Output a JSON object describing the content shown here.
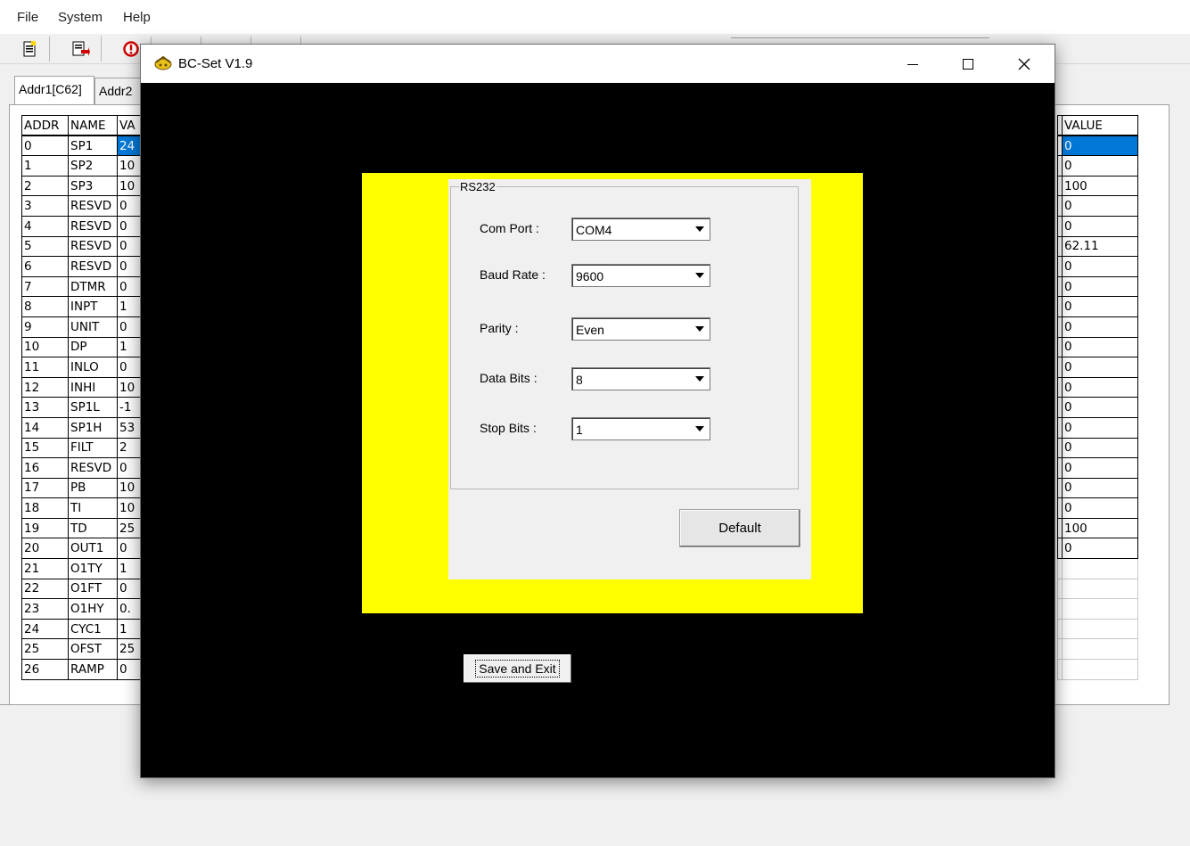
{
  "menu": [
    "File",
    "System",
    "Help"
  ],
  "toolbar": {
    "icons": [
      "new-document-icon",
      "export-icon",
      "alert-icon",
      "connect-icon",
      "disconnect-icon",
      "stop-icon"
    ]
  },
  "tabs": [
    "Addr1[C62]",
    "Addr2"
  ],
  "grid_left": {
    "headers": [
      "ADDR",
      "NAME",
      "VA"
    ],
    "rows": [
      [
        "0",
        "SP1",
        "24"
      ],
      [
        "1",
        "SP2",
        "10"
      ],
      [
        "2",
        "SP3",
        "10"
      ],
      [
        "3",
        "RESVD",
        "0"
      ],
      [
        "4",
        "RESVD",
        "0"
      ],
      [
        "5",
        "RESVD",
        "0"
      ],
      [
        "6",
        "RESVD",
        "0"
      ],
      [
        "7",
        "DTMR",
        "0"
      ],
      [
        "8",
        "INPT",
        "1"
      ],
      [
        "9",
        "UNIT",
        "0"
      ],
      [
        "10",
        "DP",
        "1"
      ],
      [
        "11",
        "INLO",
        "0"
      ],
      [
        "12",
        "INHI",
        "10"
      ],
      [
        "13",
        "SP1L",
        "-1"
      ],
      [
        "14",
        "SP1H",
        "53"
      ],
      [
        "15",
        "FILT",
        "2"
      ],
      [
        "16",
        "RESVD",
        "0"
      ],
      [
        "17",
        "PB",
        "10"
      ],
      [
        "18",
        "TI",
        "10"
      ],
      [
        "19",
        "TD",
        "25"
      ],
      [
        "20",
        "OUT1",
        "0"
      ],
      [
        "21",
        "O1TY",
        "1"
      ],
      [
        "22",
        "O1FT",
        "0"
      ],
      [
        "23",
        "O1HY",
        "0."
      ],
      [
        "24",
        "CYC1",
        "1"
      ],
      [
        "25",
        "OFST",
        "25"
      ],
      [
        "26",
        "RAMP",
        "0"
      ]
    ]
  },
  "grid_right": {
    "header": "VALUE",
    "values": [
      "0",
      "0",
      "100",
      "0",
      "0",
      "62.11",
      "0",
      "0",
      "0",
      "0",
      "0",
      "0",
      "0",
      "0",
      "0",
      "0",
      "0",
      "0",
      "0",
      "100",
      "0",
      "",
      "",
      "",
      "",
      "",
      ""
    ]
  },
  "dialog": {
    "title": "BC-Set V1.9",
    "controls": {
      "minimize": "—",
      "maximize": "☐",
      "close": "✕"
    },
    "group_title": "RS232",
    "fields": [
      {
        "label": "Com Port :",
        "value": "COM4"
      },
      {
        "label": "Baud Rate :",
        "value": "9600"
      },
      {
        "label": "Parity :",
        "value": "Even"
      },
      {
        "label": "Data Bits :",
        "value": "8"
      },
      {
        "label": "Stop Bits :",
        "value": "1"
      }
    ],
    "default_label": "Default",
    "save_exit_label": "Save and Exit"
  },
  "colors": {
    "dialog_bg": "#000000",
    "panel_highlight": "#ffff00",
    "selection": "#0078d7"
  }
}
